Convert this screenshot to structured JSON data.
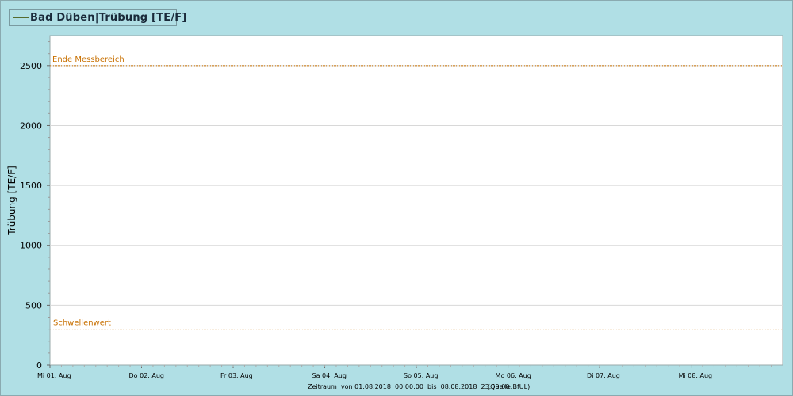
{
  "legend": {
    "label": "Bad Düben|Trübung [TE/F]",
    "line_color": "#556b2f"
  },
  "footer": {
    "zeitraum": "Zeitraum  von 01.08.2018  00:00:00  bis  08.08.2018  23:59:00",
    "quelle": "(Quelle:BfUL)"
  },
  "chart_data": {
    "type": "line",
    "title": "Bad Düben|Trübung [TE/F]",
    "ylabel": "Trübung [TE/F]",
    "xlabel": "",
    "ylim": [
      0,
      2750
    ],
    "yticks": [
      0,
      500,
      1000,
      1500,
      2000,
      2500
    ],
    "xlim": [
      "2018-08-01 00:00",
      "2018-08-08 23:59"
    ],
    "xticks": [
      {
        "date": "2018-08-01",
        "label": "Mi 01. Aug"
      },
      {
        "date": "2018-08-02",
        "label": "Do 02. Aug"
      },
      {
        "date": "2018-08-03",
        "label": "Fr 03. Aug"
      },
      {
        "date": "2018-08-04",
        "label": "Sa 04. Aug"
      },
      {
        "date": "2018-08-05",
        "label": "So 05. Aug"
      },
      {
        "date": "2018-08-06",
        "label": "Mo 06. Aug"
      },
      {
        "date": "2018-08-07",
        "label": "Di 07. Aug"
      },
      {
        "date": "2018-08-08",
        "label": "Mi 08. Aug"
      }
    ],
    "grid": true,
    "series": [
      {
        "name": "Bad Düben|Trübung [TE/F]",
        "values": []
      }
    ],
    "reference_lines": [
      {
        "label": "Ende Messbereich",
        "y": 2500,
        "color": "#c87000"
      },
      {
        "label": "Schwellenwert",
        "y": 300,
        "color": "#c87000"
      }
    ]
  }
}
